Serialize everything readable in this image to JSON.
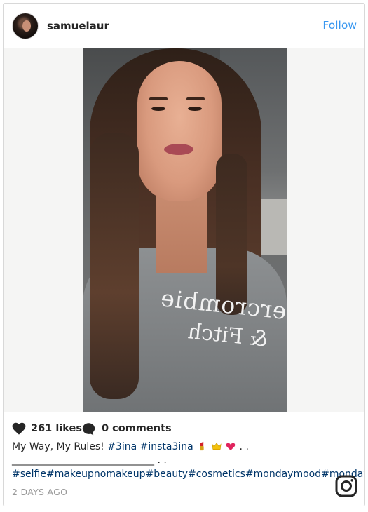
{
  "header": {
    "username": "samuelaur",
    "follow_label": "Follow"
  },
  "post": {
    "photo_text_line1": "Abercrombie",
    "photo_text_line2": "& Fitch"
  },
  "actions": {
    "likes": "261 likes",
    "comments": "0 comments",
    "heart_icon": "heart-icon",
    "comment_icon": "comment-icon"
  },
  "caption": {
    "text": "My Way, My Rules!",
    "tag1": "#3ina",
    "tag2": "#insta3ina",
    "emojis": [
      "lipstick",
      "crown",
      "heart"
    ],
    "trailing": " . .",
    "line2": "_____________________________ . .",
    "hashtags": "#selfie#makeupnomakeup#beauty#cosmetics#mondaymood#mondaym"
  },
  "timestamp": "2 DAYS AGO",
  "colors": {
    "follow": "#3897f0",
    "hashtag": "#003569",
    "timestamp": "#999999"
  },
  "icons": [
    "heart-icon",
    "comment-icon",
    "instagram-logo-icon"
  ]
}
